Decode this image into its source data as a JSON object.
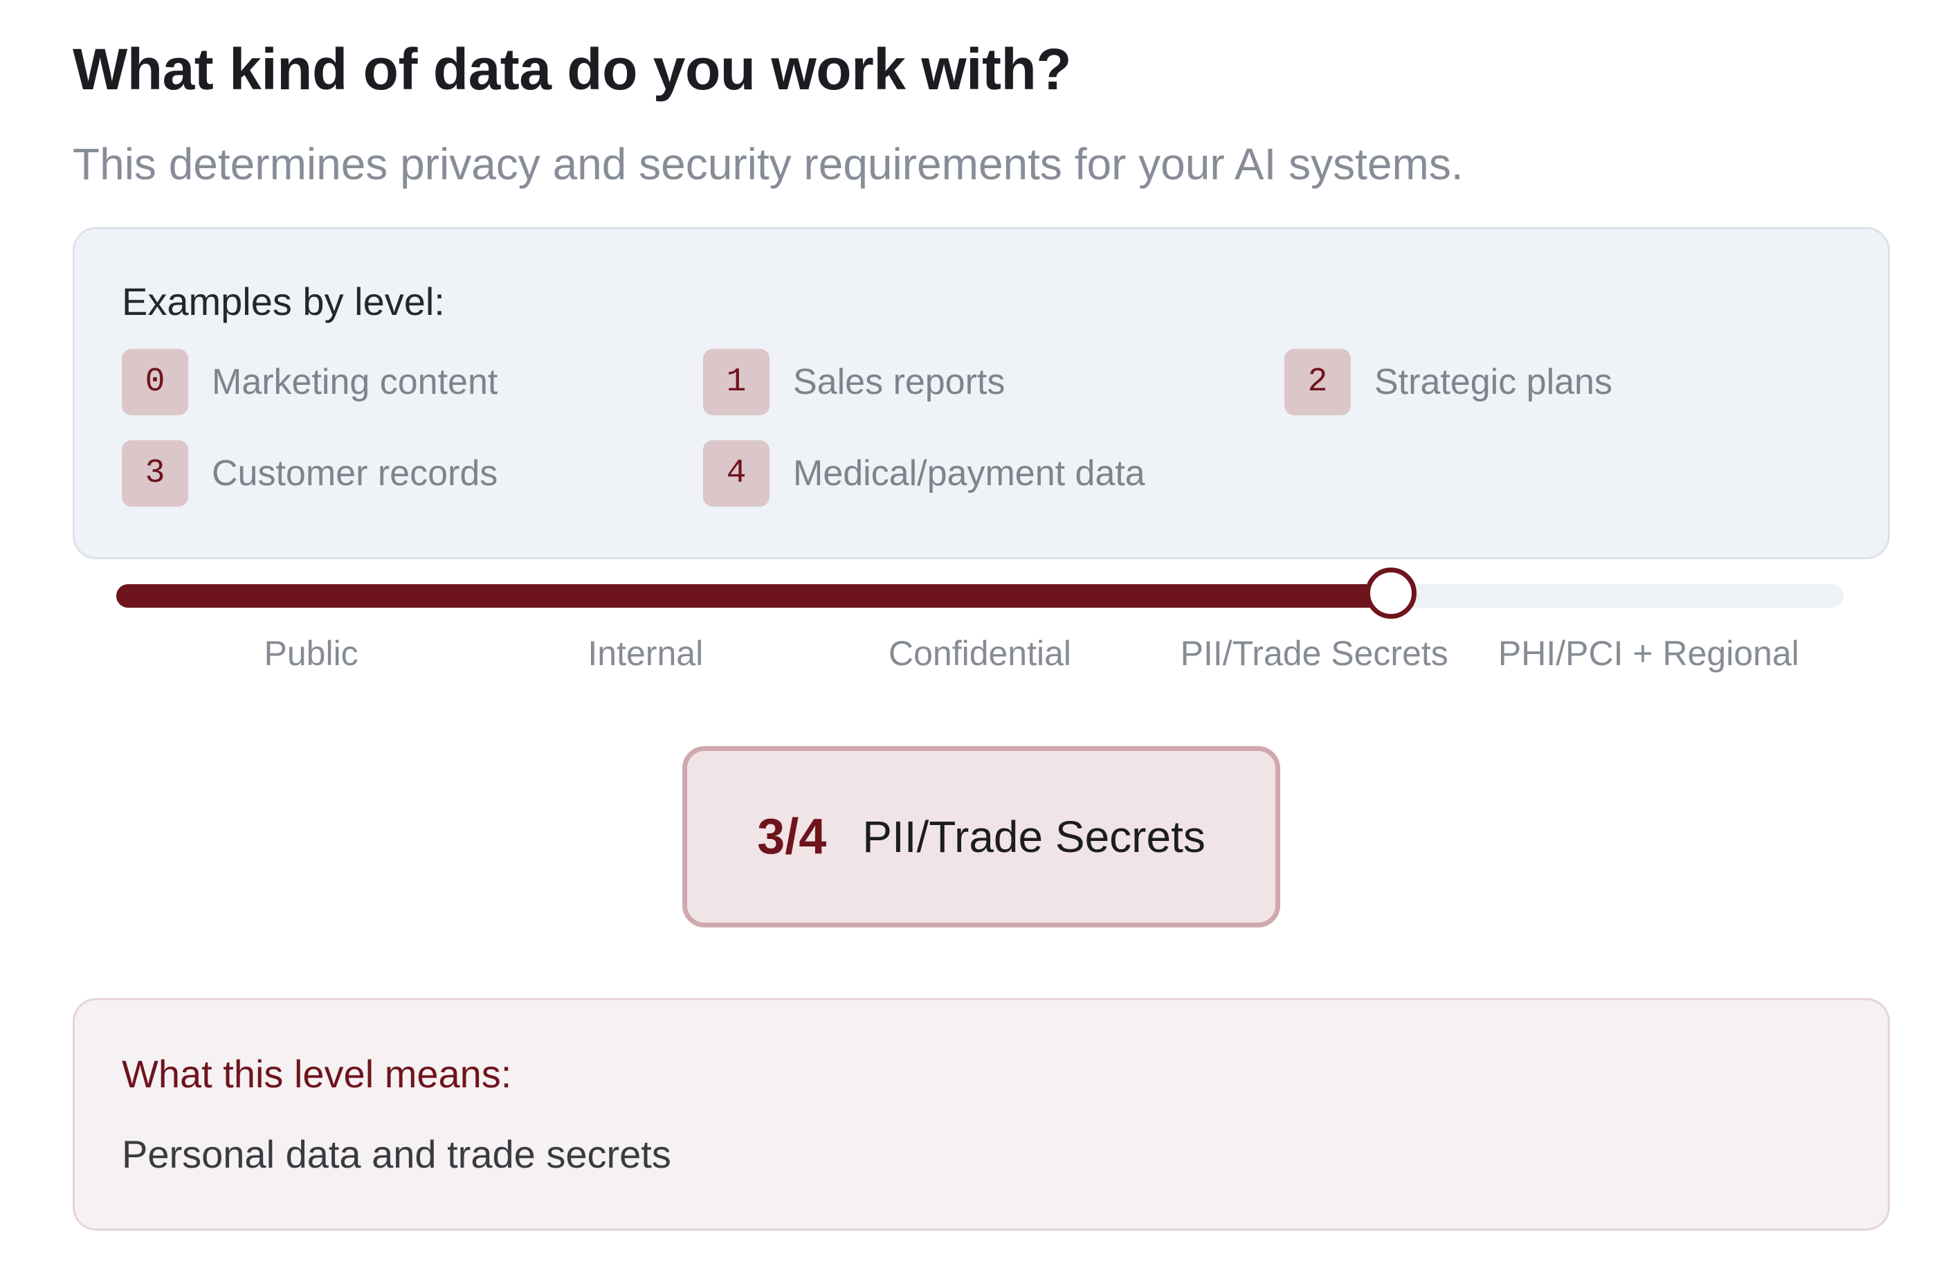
{
  "question": {
    "title": "What kind of data do you work with?",
    "subtitle": "This determines privacy and security requirements for your AI systems."
  },
  "examples": {
    "heading": "Examples by level:",
    "items": [
      {
        "level": "0",
        "label": "Marketing content"
      },
      {
        "level": "1",
        "label": "Sales reports"
      },
      {
        "level": "2",
        "label": "Strategic plans"
      },
      {
        "level": "3",
        "label": "Customer records"
      },
      {
        "level": "4",
        "label": "Medical/payment data"
      }
    ]
  },
  "slider": {
    "value": 3,
    "max": 4,
    "labels": [
      "Public",
      "Internal",
      "Confidential",
      "PII/Trade Secrets",
      "PHI/PCI + Regional"
    ]
  },
  "current": {
    "score": "3/4",
    "name": "PII/Trade Secrets"
  },
  "meaning": {
    "heading": "What this level means:",
    "text": "Personal data and trade secrets"
  },
  "colors": {
    "accent": "#6e141c",
    "badge_bg": "#dbc6ca",
    "track": "#eef1f5",
    "examples_bg": "#eff2f7",
    "current_bg": "#f1e4e6",
    "meaning_bg": "#f6f1f2"
  }
}
